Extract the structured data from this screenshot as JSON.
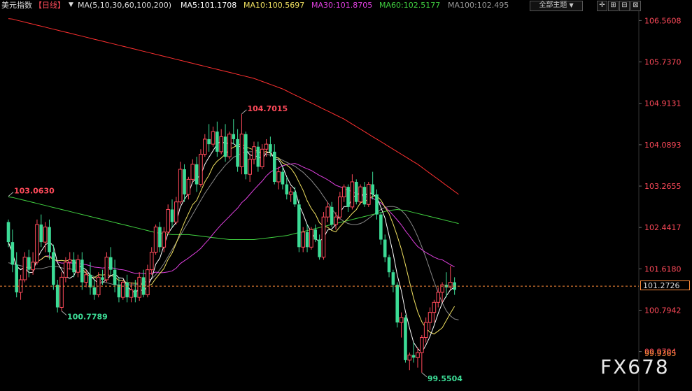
{
  "header": {
    "instrument": "美元指数",
    "period": "【日线】",
    "ma_params": "MA(5,10,30,60,100,200)",
    "ma5": "MA5:101.1708",
    "ma10": "MA10:100.5697",
    "ma30": "MA30:101.8705",
    "ma60": "MA60:102.5177",
    "ma100": "MA100:102.495",
    "theme_button": "全部主题",
    "theme_arrow": "▼",
    "icons": [
      "crosshair-icon",
      "zoom-in-icon",
      "zoom-out-icon",
      "close-icon"
    ]
  },
  "current_price": "101.2726",
  "watermark": "FX678",
  "colors": {
    "up": "#ff4a5a",
    "down": "#3cdc96",
    "ma5": "#ffffff",
    "ma10": "#f0e060",
    "ma30": "#e040e0",
    "ma60": "#40d040",
    "ma100": "#888888",
    "ma200": "#ff3030",
    "axis_label": "#ff4a5a",
    "price_line": "#ff8c3a"
  },
  "chart_data": {
    "type": "candlestick",
    "ylim": [
      99.45,
      106.72
    ],
    "y_ticks": [
      "106.5608",
      "105.7370",
      "104.9131",
      "104.0893",
      "103.2655",
      "102.4417",
      "101.6180",
      "100.7942",
      "99.9704"
    ],
    "last_price_label": "99.9365",
    "annotations": [
      {
        "text": "104.7015",
        "value": 104.7015,
        "index": 57,
        "color": "#ff4a5a"
      },
      {
        "text": "103.0630",
        "value": 103.063,
        "index": 0,
        "color": "#ff4a5a"
      },
      {
        "text": "100.7789",
        "value": 100.7789,
        "index": 13,
        "color": "#3cdc96"
      },
      {
        "text": "99.5504",
        "value": 99.5504,
        "index": 101,
        "color": "#3cdc96"
      }
    ],
    "candles": [
      [
        102.55,
        102.6,
        102.05,
        102.15
      ],
      [
        102.15,
        102.4,
        101.55,
        101.7
      ],
      [
        101.7,
        101.95,
        101.05,
        101.15
      ],
      [
        101.15,
        101.5,
        101.0,
        101.4
      ],
      [
        101.4,
        101.95,
        101.35,
        101.85
      ],
      [
        101.85,
        102.0,
        101.45,
        101.6
      ],
      [
        101.6,
        101.95,
        101.5,
        101.75
      ],
      [
        101.75,
        102.6,
        101.7,
        102.5
      ],
      [
        102.5,
        102.7,
        102.05,
        102.15
      ],
      [
        102.15,
        102.55,
        101.95,
        102.45
      ],
      [
        102.45,
        102.6,
        101.8,
        101.95
      ],
      [
        101.95,
        102.1,
        101.2,
        101.3
      ],
      [
        101.3,
        101.4,
        100.75,
        100.85
      ],
      [
        100.85,
        101.55,
        100.78,
        101.45
      ],
      [
        101.45,
        101.85,
        101.35,
        101.75
      ],
      [
        101.75,
        101.95,
        101.6,
        101.8
      ],
      [
        101.8,
        101.95,
        101.45,
        101.55
      ],
      [
        101.55,
        101.9,
        101.45,
        101.8
      ],
      [
        101.8,
        101.95,
        101.2,
        101.35
      ],
      [
        101.35,
        101.6,
        101.25,
        101.5
      ],
      [
        101.5,
        101.75,
        101.1,
        101.25
      ],
      [
        101.25,
        101.4,
        101.0,
        101.1
      ],
      [
        101.1,
        101.55,
        101.05,
        101.45
      ],
      [
        101.45,
        101.6,
        101.3,
        101.4
      ],
      [
        101.4,
        101.95,
        101.35,
        101.85
      ],
      [
        101.85,
        102.05,
        101.5,
        101.6
      ],
      [
        101.6,
        101.8,
        101.15,
        101.3
      ],
      [
        101.3,
        101.45,
        100.95,
        101.05
      ],
      [
        101.05,
        101.4,
        101.0,
        101.35
      ],
      [
        101.35,
        101.5,
        100.95,
        101.05
      ],
      [
        101.05,
        101.35,
        100.95,
        101.2
      ],
      [
        101.2,
        101.4,
        100.95,
        101.05
      ],
      [
        101.05,
        101.55,
        100.98,
        101.45
      ],
      [
        101.45,
        101.6,
        101.05,
        101.1
      ],
      [
        101.1,
        101.7,
        101.05,
        101.6
      ],
      [
        101.6,
        102.05,
        101.5,
        101.95
      ],
      [
        101.95,
        102.5,
        101.9,
        102.45
      ],
      [
        102.45,
        102.55,
        101.95,
        102.05
      ],
      [
        102.05,
        102.45,
        101.95,
        102.35
      ],
      [
        102.35,
        102.9,
        102.3,
        102.8
      ],
      [
        102.8,
        103.0,
        102.45,
        102.55
      ],
      [
        102.55,
        103.05,
        102.5,
        102.95
      ],
      [
        102.95,
        103.75,
        102.9,
        103.6
      ],
      [
        103.6,
        103.7,
        102.95,
        103.1
      ],
      [
        103.1,
        103.45,
        103.0,
        103.4
      ],
      [
        103.4,
        103.8,
        103.35,
        103.7
      ],
      [
        103.7,
        103.85,
        103.15,
        103.3
      ],
      [
        103.3,
        104.0,
        103.25,
        103.9
      ],
      [
        103.9,
        104.3,
        103.85,
        104.2
      ],
      [
        104.2,
        104.5,
        103.95,
        104.1
      ],
      [
        104.1,
        104.45,
        104.05,
        104.35
      ],
      [
        104.35,
        104.55,
        103.85,
        103.95
      ],
      [
        103.95,
        104.4,
        103.9,
        104.25
      ],
      [
        104.25,
        104.5,
        103.75,
        103.85
      ],
      [
        103.85,
        104.35,
        103.8,
        104.3
      ],
      [
        104.3,
        104.6,
        104.1,
        104.2
      ],
      [
        104.2,
        104.4,
        103.55,
        103.65
      ],
      [
        103.65,
        104.7,
        103.5,
        104.3
      ],
      [
        104.3,
        104.35,
        103.4,
        103.5
      ],
      [
        103.5,
        103.9,
        103.35,
        103.8
      ],
      [
        103.8,
        104.15,
        103.7,
        104.05
      ],
      [
        104.05,
        104.15,
        103.55,
        103.65
      ],
      [
        103.65,
        104.1,
        103.6,
        104.0
      ],
      [
        104.0,
        104.2,
        103.85,
        104.1
      ],
      [
        104.1,
        104.25,
        103.85,
        103.95
      ],
      [
        103.95,
        104.1,
        103.3,
        103.35
      ],
      [
        103.35,
        103.65,
        103.2,
        103.55
      ],
      [
        103.55,
        103.65,
        103.2,
        103.3
      ],
      [
        103.3,
        103.45,
        103.0,
        103.1
      ],
      [
        103.1,
        103.25,
        102.95,
        103.15
      ],
      [
        103.15,
        103.25,
        102.85,
        102.9
      ],
      [
        102.9,
        103.0,
        101.95,
        102.05
      ],
      [
        102.05,
        102.45,
        101.95,
        102.35
      ],
      [
        102.35,
        102.5,
        101.95,
        102.05
      ],
      [
        102.05,
        102.45,
        102.0,
        102.4
      ],
      [
        102.4,
        102.5,
        102.15,
        102.2
      ],
      [
        102.2,
        102.3,
        101.8,
        101.85
      ],
      [
        101.85,
        102.75,
        101.8,
        102.65
      ],
      [
        102.65,
        102.95,
        102.55,
        102.85
      ],
      [
        102.85,
        102.95,
        102.45,
        102.5
      ],
      [
        102.5,
        102.75,
        102.4,
        102.65
      ],
      [
        102.65,
        103.15,
        102.6,
        103.05
      ],
      [
        103.05,
        103.3,
        102.95,
        103.25
      ],
      [
        103.25,
        103.3,
        102.75,
        102.85
      ],
      [
        102.85,
        103.5,
        102.8,
        103.35
      ],
      [
        103.35,
        103.4,
        102.9,
        102.95
      ],
      [
        102.95,
        103.3,
        102.9,
        103.25
      ],
      [
        103.25,
        103.35,
        102.85,
        102.9
      ],
      [
        102.9,
        103.35,
        102.85,
        103.3
      ],
      [
        103.3,
        103.55,
        103.0,
        103.1
      ],
      [
        103.1,
        103.2,
        102.6,
        102.7
      ],
      [
        102.7,
        102.75,
        102.1,
        102.2
      ],
      [
        102.2,
        102.3,
        101.75,
        101.85
      ],
      [
        101.85,
        101.9,
        101.45,
        101.55
      ],
      [
        101.55,
        101.6,
        101.15,
        101.3
      ],
      [
        101.3,
        101.35,
        100.45,
        100.55
      ],
      [
        100.55,
        100.75,
        100.25,
        100.65
      ],
      [
        100.65,
        100.7,
        99.75,
        99.8
      ],
      [
        99.8,
        99.95,
        99.6,
        99.9
      ],
      [
        99.9,
        100.15,
        99.75,
        99.85
      ],
      [
        99.85,
        100.05,
        99.65,
        99.95
      ],
      [
        99.95,
        100.3,
        99.55,
        100.25
      ],
      [
        100.25,
        100.65,
        100.15,
        100.55
      ],
      [
        100.55,
        100.85,
        100.4,
        100.75
      ],
      [
        100.75,
        101.0,
        100.55,
        100.95
      ],
      [
        100.95,
        101.25,
        100.85,
        101.15
      ],
      [
        101.15,
        101.35,
        100.95,
        101.3
      ],
      [
        101.3,
        101.55,
        101.05,
        101.25
      ],
      [
        101.25,
        101.68,
        101.2,
        101.35
      ],
      [
        101.35,
        101.45,
        101.1,
        101.2
      ]
    ],
    "moving_averages": [
      {
        "name": "MA5",
        "values": [
          101.74,
          101.72,
          101.7,
          101.68,
          101.66,
          101.64,
          101.62,
          101.62,
          101.62,
          101.64,
          101.66,
          101.66,
          101.66,
          101.64,
          101.62,
          101.62,
          101.6,
          101.58,
          101.56,
          101.54,
          101.5,
          101.46,
          101.4,
          101.36,
          101.34,
          101.32,
          101.3,
          101.3,
          101.3,
          101.3,
          101.3,
          101.3,
          101.32,
          101.34,
          101.38,
          101.42,
          101.5,
          101.6,
          101.72,
          101.86,
          102.0,
          102.14,
          102.28,
          102.42,
          102.56,
          102.7,
          102.84,
          102.98,
          103.12,
          103.24,
          103.36,
          103.48,
          103.58,
          103.68,
          103.76,
          103.84,
          103.88,
          103.92,
          103.94,
          103.95,
          103.95,
          103.94,
          103.92,
          103.9,
          103.88,
          103.85,
          103.82,
          103.78,
          103.74,
          103.7,
          103.66,
          103.6,
          103.54,
          103.46,
          103.38,
          103.28,
          103.18,
          103.06,
          102.94,
          102.82,
          102.7,
          102.62,
          102.56,
          102.52,
          102.5,
          102.5,
          102.52,
          102.56,
          102.62,
          102.68,
          102.74,
          102.8,
          102.84,
          102.86,
          102.86,
          102.84,
          102.78,
          102.7,
          102.58,
          102.44,
          102.26,
          102.06,
          101.84,
          101.6,
          101.36,
          101.14,
          100.94,
          100.78,
          100.68,
          100.62,
          100.6
        ],
        "color": "#888888"
      },
      {
        "name": "MA60",
        "values": [
          103.05,
          103.04,
          103.02,
          103.0,
          102.98,
          102.96,
          102.94,
          102.92,
          102.9,
          102.88,
          102.86,
          102.84,
          102.82,
          102.8,
          102.78,
          102.76,
          102.74,
          102.72,
          102.7,
          102.68,
          102.66,
          102.64,
          102.62,
          102.6,
          102.58,
          102.56,
          102.54,
          102.52,
          102.5,
          102.48,
          102.46,
          102.44,
          102.42,
          102.4,
          102.38,
          102.36,
          102.34,
          102.33,
          102.32,
          102.31,
          102.3,
          102.3,
          102.3,
          102.3,
          102.3,
          102.29,
          102.28,
          102.27,
          102.26,
          102.25,
          102.24,
          102.23,
          102.22,
          102.21,
          102.2,
          102.2,
          102.2,
          102.2,
          102.2,
          102.2,
          102.2,
          102.21,
          102.22,
          102.23,
          102.24,
          102.25,
          102.26,
          102.27,
          102.28,
          102.3,
          102.32,
          102.34,
          102.36,
          102.38,
          102.4,
          102.42,
          102.44,
          102.46,
          102.48,
          102.5,
          102.52,
          102.54,
          102.56,
          102.58,
          102.6,
          102.62,
          102.64,
          102.66,
          102.68,
          102.7,
          102.72,
          102.74,
          102.76,
          102.78,
          102.79,
          102.8,
          102.79,
          102.78,
          102.76,
          102.74,
          102.72,
          102.7,
          102.68,
          102.66,
          102.64,
          102.62,
          102.6,
          102.58,
          102.56,
          102.54,
          102.52
        ],
        "color": "#40d040"
      },
      {
        "name": "MA200",
        "values": [
          106.6,
          106.59,
          106.57,
          106.55,
          106.53,
          106.51,
          106.49,
          106.47,
          106.45,
          106.43,
          106.41,
          106.39,
          106.37,
          106.35,
          106.33,
          106.31,
          106.29,
          106.27,
          106.25,
          106.23,
          106.21,
          106.19,
          106.17,
          106.15,
          106.13,
          106.11,
          106.09,
          106.07,
          106.05,
          106.03,
          106.01,
          105.99,
          105.97,
          105.95,
          105.93,
          105.91,
          105.89,
          105.87,
          105.85,
          105.83,
          105.81,
          105.79,
          105.77,
          105.75,
          105.73,
          105.71,
          105.69,
          105.67,
          105.65,
          105.63,
          105.61,
          105.59,
          105.57,
          105.55,
          105.53,
          105.51,
          105.49,
          105.47,
          105.45,
          105.43,
          105.41,
          105.38,
          105.35,
          105.32,
          105.29,
          105.26,
          105.23,
          105.2,
          105.16,
          105.12,
          105.08,
          105.04,
          105.0,
          104.96,
          104.92,
          104.88,
          104.84,
          104.8,
          104.76,
          104.72,
          104.68,
          104.64,
          104.6,
          104.55,
          104.5,
          104.45,
          104.4,
          104.35,
          104.3,
          104.25,
          104.2,
          104.15,
          104.1,
          104.05,
          104.0,
          103.95,
          103.9,
          103.85,
          103.8,
          103.75,
          103.7,
          103.64,
          103.58,
          103.52,
          103.46,
          103.4,
          103.34,
          103.28,
          103.22,
          103.16,
          103.1
        ],
        "color": "#ff3030"
      }
    ]
  }
}
